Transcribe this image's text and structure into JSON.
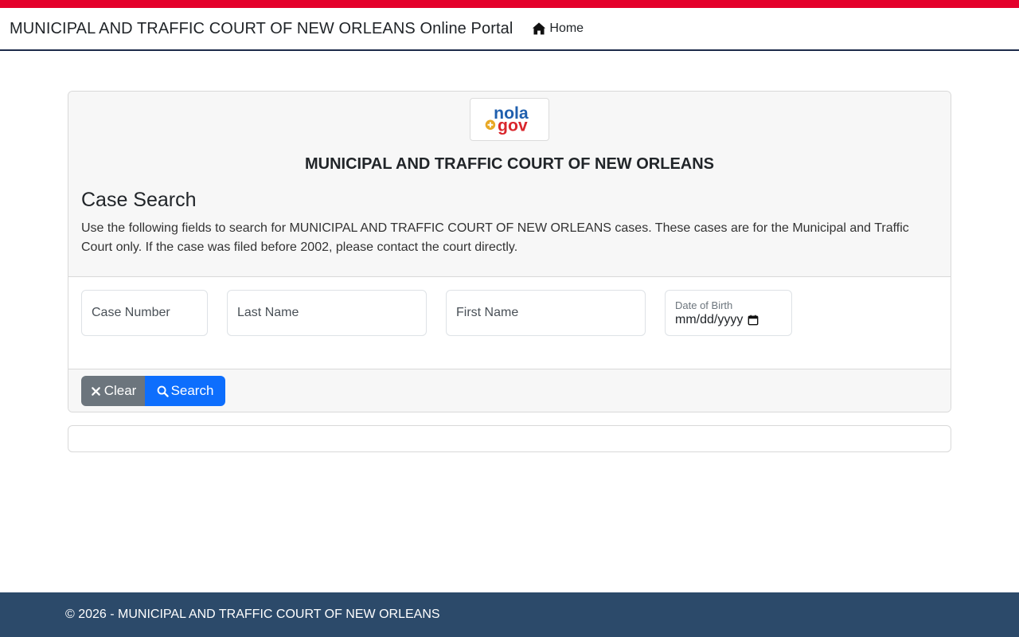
{
  "colors": {
    "top_stripe": "#e4002b",
    "navbar_border": "#1c2a4a",
    "footer_bg": "#2c4a6a",
    "clear_button": "#6c757d",
    "search_button": "#0d6efd",
    "logo_blue": "#1f5fae",
    "logo_red": "#d9262c",
    "logo_gold": "#e8a825"
  },
  "navbar": {
    "brand": "MUNICIPAL AND TRAFFIC COURT OF NEW ORLEANS Online Portal",
    "home_label": "Home",
    "home_icon": "home-icon"
  },
  "logo": {
    "line1": "nola",
    "line2": "gov",
    "symbol": "plus-icon"
  },
  "card": {
    "court_title": "MUNICIPAL AND TRAFFIC COURT OF NEW ORLEANS",
    "search_title": "Case Search",
    "description": "Use the following fields to search for MUNICIPAL AND TRAFFIC COURT OF NEW ORLEANS cases. These cases are for the Municipal and Traffic Court only. If the case was filed before 2002, please contact the court directly."
  },
  "fields": {
    "case_number_placeholder": "Case Number",
    "last_name_placeholder": "Last Name",
    "first_name_placeholder": "First Name",
    "dob_label": "Date of Birth",
    "dob_value": "mm/dd/yyyy",
    "dob_icon": "calendar-icon"
  },
  "buttons": {
    "clear_label": "Clear",
    "clear_icon": "close-icon",
    "search_label": "Search",
    "search_icon": "search-icon"
  },
  "footer": {
    "text": "© 2026 - MUNICIPAL AND TRAFFIC COURT OF NEW ORLEANS"
  }
}
